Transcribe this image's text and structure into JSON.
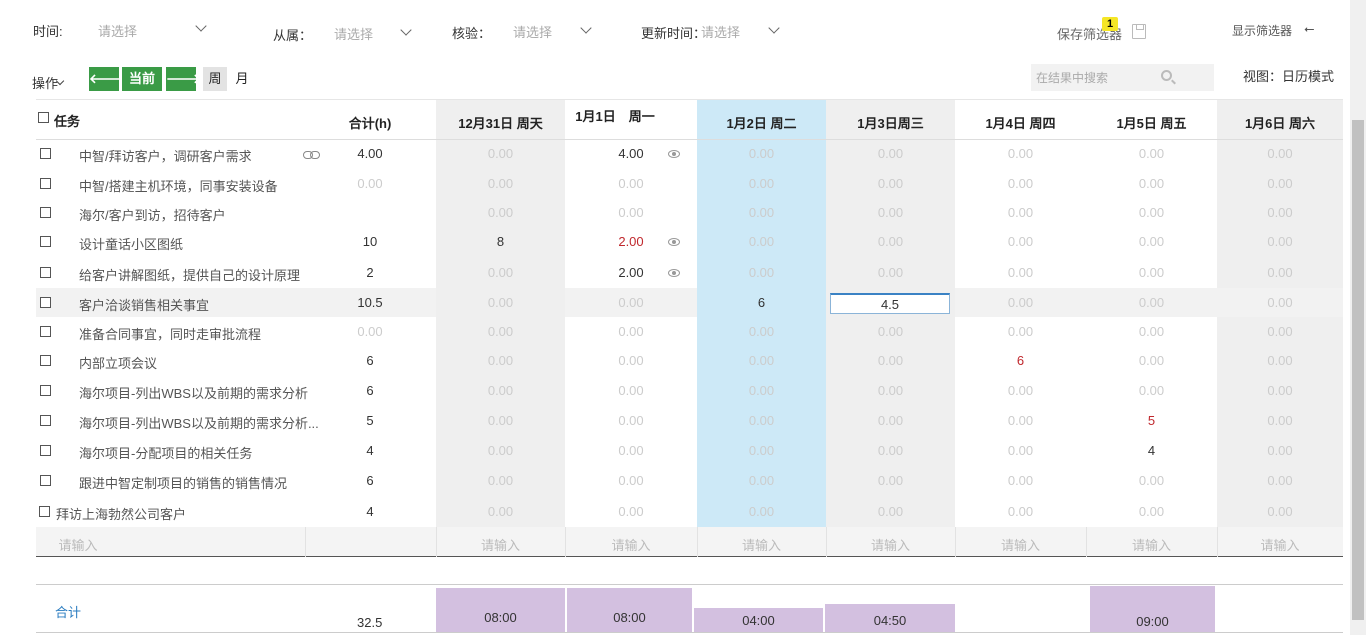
{
  "filters": {
    "time_label": "时间:",
    "time_value": "请选择",
    "belong_label": "从属：",
    "belong_value": "请选择",
    "verify_label": "核验：",
    "verify_value": "请选择",
    "updated_label": "更新时间：",
    "updated_value": "请选择",
    "save_filter": "保存筛选器",
    "save_badge": "1",
    "show_filter": "显示筛选器"
  },
  "toolbar": {
    "ops_label": "操作",
    "prev_icon": "🡐",
    "current_label": "当前",
    "next_icon": "🡒",
    "week_label": "周",
    "month_label": "月",
    "search_placeholder": "在结果中搜索",
    "view_mode": "视图：日历模式"
  },
  "columns": {
    "task": "任务",
    "total": "合计(h)",
    "days": [
      "12月31日 周天",
      "1月1日　周一",
      "1月2日 周二",
      "1月3日周三",
      "1月4日 周四",
      "1月5日 周五",
      "1月6日 周六"
    ]
  },
  "rows": [
    {
      "task": "中智/拜访客户，调研客户需求",
      "total": "4.00",
      "days": [
        "0.00",
        "4.00",
        "0.00",
        "0.00",
        "0.00",
        "0.00",
        "0.00"
      ]
    },
    {
      "task": "中智/搭建主机环境，同事安装设备",
      "total": "0.00",
      "days": [
        "0.00",
        "0.00",
        "0.00",
        "0.00",
        "0.00",
        "0.00",
        "0.00"
      ]
    },
    {
      "task": "海尔/客户到访，招待客户",
      "total": "",
      "days": [
        "0.00",
        "0.00",
        "0.00",
        "0.00",
        "0.00",
        "0.00",
        "0.00"
      ]
    },
    {
      "task": "设计童话小区图纸",
      "total": "10",
      "days": [
        "8",
        "2.00",
        "0.00",
        "0.00",
        "0.00",
        "0.00",
        "0.00"
      ]
    },
    {
      "task": "给客户讲解图纸，提供自己的设计原理",
      "total": "2",
      "days": [
        "0.00",
        "2.00",
        "0.00",
        "0.00",
        "0.00",
        "0.00",
        "0.00"
      ]
    },
    {
      "task": "客户洽谈销售相关事宜",
      "total": "10.5",
      "days": [
        "0.00",
        "0.00",
        "6",
        "4.5",
        "0.00",
        "0.00",
        "0.00"
      ]
    },
    {
      "task": "准备合同事宜，同时走审批流程",
      "total": "0.00",
      "days": [
        "0.00",
        "0.00",
        "0.00",
        "0.00",
        "0.00",
        "0.00",
        "0.00"
      ]
    },
    {
      "task": "内部立项会议",
      "total": "6",
      "days": [
        "0.00",
        "0.00",
        "0.00",
        "0.00",
        "6",
        "0.00",
        "0.00"
      ]
    },
    {
      "task": "海尔项目-列出WBS以及前期的需求分析",
      "total": "6",
      "days": [
        "0.00",
        "0.00",
        "0.00",
        "0.00",
        "0.00",
        "0.00",
        "0.00"
      ]
    },
    {
      "task": "海尔项目-列出WBS以及前期的需求分析...",
      "total": "5",
      "days": [
        "0.00",
        "0.00",
        "0.00",
        "0.00",
        "0.00",
        "5",
        "0.00"
      ]
    },
    {
      "task": "海尔项目-分配项目的相关任务",
      "total": "4",
      "days": [
        "0.00",
        "0.00",
        "0.00",
        "0.00",
        "0.00",
        "4",
        "0.00"
      ]
    },
    {
      "task": "跟进中智定制项目的销售的销售情况",
      "total": "6",
      "days": [
        "0.00",
        "0.00",
        "0.00",
        "0.00",
        "0.00",
        "0.00",
        "0.00"
      ]
    },
    {
      "task": "拜访上海勃然公司客户",
      "total": "4",
      "days": [
        "0.00",
        "0.00",
        "0.00",
        "0.00",
        "0.00",
        "0.00",
        "0.00"
      ]
    }
  ],
  "input_placeholder": "请输入",
  "totals": {
    "label": "合计",
    "sum": "32.5",
    "days": [
      "08:00",
      "08:00",
      "04:00",
      "04:50",
      "",
      "09:00",
      ""
    ]
  },
  "colors": {
    "green_button": "#3a9b46",
    "today_column": "#cde9f7",
    "weekend_column": "#efefef",
    "red_value": "#c0282d",
    "total_bar": "#d3c0e0",
    "link_blue": "#2a7cc0"
  }
}
